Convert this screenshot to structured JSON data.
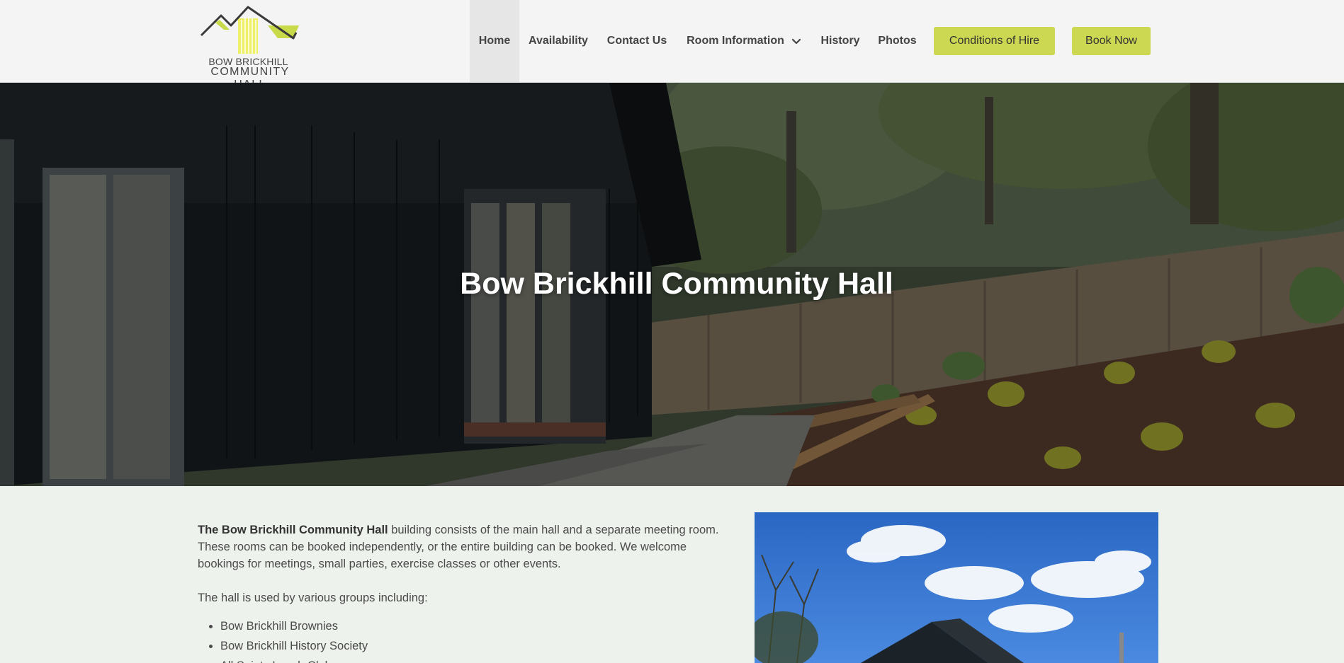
{
  "logo": {
    "line1": "BOW BRICKHILL",
    "line2": "COMMUNITY HALL"
  },
  "nav": {
    "home": "Home",
    "availability": "Availability",
    "contact": "Contact Us",
    "room_information": "Room Information",
    "history": "History",
    "photos": "Photos"
  },
  "buttons": {
    "conditions": "Conditions of Hire",
    "book": "Book Now"
  },
  "hero": {
    "title": "Bow Brickhill Community Hall"
  },
  "intro": {
    "bold": "The Bow Brickhill Community Hall",
    "rest": " building consists of the main hall and a separate meeting room. These rooms can be booked independently, or the entire building can be booked. We welcome bookings for meetings, small parties, exercise classes or other events.",
    "groups_intro": "The hall is used by various groups including:",
    "groups": [
      "Bow Brickhill Brownies",
      "Bow Brickhill History Society",
      "All Saints Lunch Club"
    ]
  },
  "colors": {
    "accent": "#cdd852",
    "header_bg": "#f4f4f4",
    "page_bg": "#eef2ec"
  }
}
